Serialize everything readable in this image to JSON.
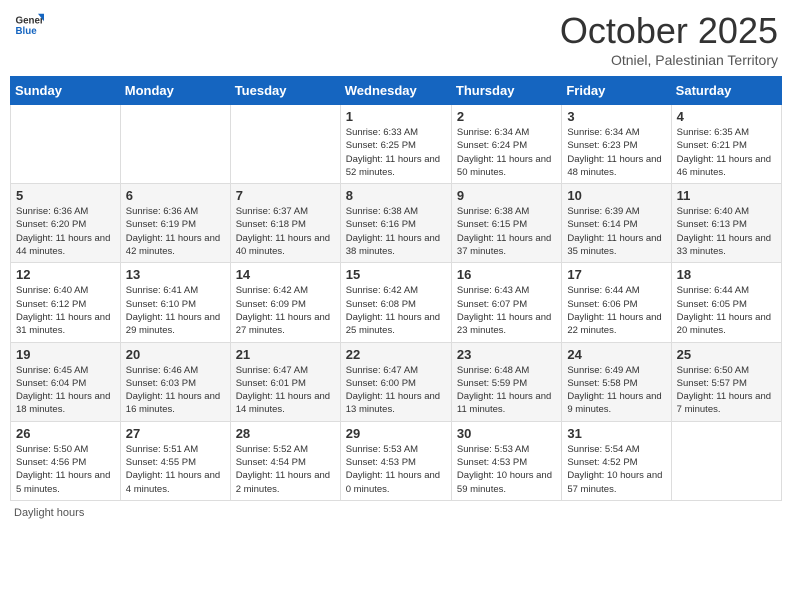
{
  "logo": {
    "general": "General",
    "blue": "Blue"
  },
  "title": "October 2025",
  "location": "Otniel, Palestinian Territory",
  "days_of_week": [
    "Sunday",
    "Monday",
    "Tuesday",
    "Wednesday",
    "Thursday",
    "Friday",
    "Saturday"
  ],
  "weeks": [
    [
      {
        "day": "",
        "info": ""
      },
      {
        "day": "",
        "info": ""
      },
      {
        "day": "",
        "info": ""
      },
      {
        "day": "1",
        "info": "Sunrise: 6:33 AM\nSunset: 6:25 PM\nDaylight: 11 hours and 52 minutes."
      },
      {
        "day": "2",
        "info": "Sunrise: 6:34 AM\nSunset: 6:24 PM\nDaylight: 11 hours and 50 minutes."
      },
      {
        "day": "3",
        "info": "Sunrise: 6:34 AM\nSunset: 6:23 PM\nDaylight: 11 hours and 48 minutes."
      },
      {
        "day": "4",
        "info": "Sunrise: 6:35 AM\nSunset: 6:21 PM\nDaylight: 11 hours and 46 minutes."
      }
    ],
    [
      {
        "day": "5",
        "info": "Sunrise: 6:36 AM\nSunset: 6:20 PM\nDaylight: 11 hours and 44 minutes."
      },
      {
        "day": "6",
        "info": "Sunrise: 6:36 AM\nSunset: 6:19 PM\nDaylight: 11 hours and 42 minutes."
      },
      {
        "day": "7",
        "info": "Sunrise: 6:37 AM\nSunset: 6:18 PM\nDaylight: 11 hours and 40 minutes."
      },
      {
        "day": "8",
        "info": "Sunrise: 6:38 AM\nSunset: 6:16 PM\nDaylight: 11 hours and 38 minutes."
      },
      {
        "day": "9",
        "info": "Sunrise: 6:38 AM\nSunset: 6:15 PM\nDaylight: 11 hours and 37 minutes."
      },
      {
        "day": "10",
        "info": "Sunrise: 6:39 AM\nSunset: 6:14 PM\nDaylight: 11 hours and 35 minutes."
      },
      {
        "day": "11",
        "info": "Sunrise: 6:40 AM\nSunset: 6:13 PM\nDaylight: 11 hours and 33 minutes."
      }
    ],
    [
      {
        "day": "12",
        "info": "Sunrise: 6:40 AM\nSunset: 6:12 PM\nDaylight: 11 hours and 31 minutes."
      },
      {
        "day": "13",
        "info": "Sunrise: 6:41 AM\nSunset: 6:10 PM\nDaylight: 11 hours and 29 minutes."
      },
      {
        "day": "14",
        "info": "Sunrise: 6:42 AM\nSunset: 6:09 PM\nDaylight: 11 hours and 27 minutes."
      },
      {
        "day": "15",
        "info": "Sunrise: 6:42 AM\nSunset: 6:08 PM\nDaylight: 11 hours and 25 minutes."
      },
      {
        "day": "16",
        "info": "Sunrise: 6:43 AM\nSunset: 6:07 PM\nDaylight: 11 hours and 23 minutes."
      },
      {
        "day": "17",
        "info": "Sunrise: 6:44 AM\nSunset: 6:06 PM\nDaylight: 11 hours and 22 minutes."
      },
      {
        "day": "18",
        "info": "Sunrise: 6:44 AM\nSunset: 6:05 PM\nDaylight: 11 hours and 20 minutes."
      }
    ],
    [
      {
        "day": "19",
        "info": "Sunrise: 6:45 AM\nSunset: 6:04 PM\nDaylight: 11 hours and 18 minutes."
      },
      {
        "day": "20",
        "info": "Sunrise: 6:46 AM\nSunset: 6:03 PM\nDaylight: 11 hours and 16 minutes."
      },
      {
        "day": "21",
        "info": "Sunrise: 6:47 AM\nSunset: 6:01 PM\nDaylight: 11 hours and 14 minutes."
      },
      {
        "day": "22",
        "info": "Sunrise: 6:47 AM\nSunset: 6:00 PM\nDaylight: 11 hours and 13 minutes."
      },
      {
        "day": "23",
        "info": "Sunrise: 6:48 AM\nSunset: 5:59 PM\nDaylight: 11 hours and 11 minutes."
      },
      {
        "day": "24",
        "info": "Sunrise: 6:49 AM\nSunset: 5:58 PM\nDaylight: 11 hours and 9 minutes."
      },
      {
        "day": "25",
        "info": "Sunrise: 6:50 AM\nSunset: 5:57 PM\nDaylight: 11 hours and 7 minutes."
      }
    ],
    [
      {
        "day": "26",
        "info": "Sunrise: 5:50 AM\nSunset: 4:56 PM\nDaylight: 11 hours and 5 minutes."
      },
      {
        "day": "27",
        "info": "Sunrise: 5:51 AM\nSunset: 4:55 PM\nDaylight: 11 hours and 4 minutes."
      },
      {
        "day": "28",
        "info": "Sunrise: 5:52 AM\nSunset: 4:54 PM\nDaylight: 11 hours and 2 minutes."
      },
      {
        "day": "29",
        "info": "Sunrise: 5:53 AM\nSunset: 4:53 PM\nDaylight: 11 hours and 0 minutes."
      },
      {
        "day": "30",
        "info": "Sunrise: 5:53 AM\nSunset: 4:53 PM\nDaylight: 10 hours and 59 minutes."
      },
      {
        "day": "31",
        "info": "Sunrise: 5:54 AM\nSunset: 4:52 PM\nDaylight: 10 hours and 57 minutes."
      },
      {
        "day": "",
        "info": ""
      }
    ]
  ],
  "footer": "Daylight hours"
}
